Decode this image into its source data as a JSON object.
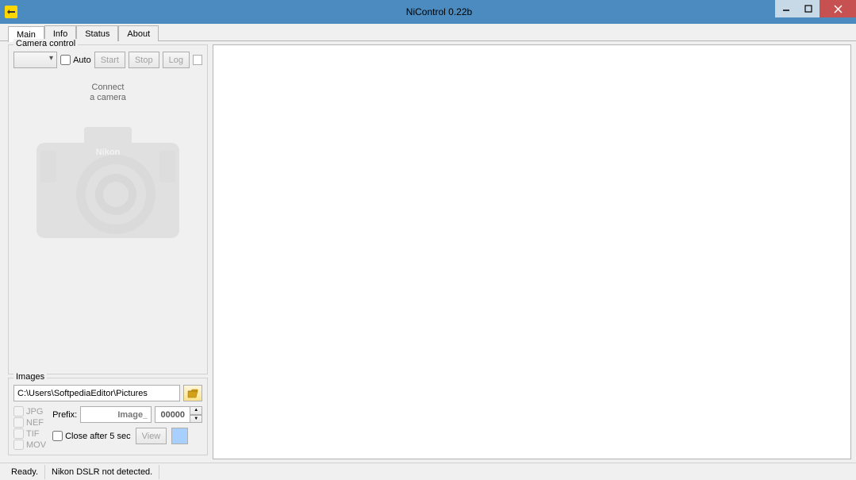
{
  "window": {
    "title": "NiControl 0.22b"
  },
  "tabs": {
    "main": "Main",
    "info": "Info",
    "status": "Status",
    "about": "About"
  },
  "camera_control": {
    "legend": "Camera control",
    "auto_label": "Auto",
    "start_label": "Start",
    "stop_label": "Stop",
    "log_label": "Log",
    "connect_line1": "Connect",
    "connect_line2": "a camera",
    "camera_brand": "Nikon"
  },
  "images": {
    "legend": "Images",
    "path_value": "C:\\Users\\SoftpediaEditor\\Pictures",
    "formats": {
      "jpg": "JPG",
      "nef": "NEF",
      "tif": "TIF",
      "mov": "MOV"
    },
    "prefix_label": "Prefix:",
    "prefix_value": "Image_",
    "counter_value": "00000",
    "close_after_label": "Close after 5 sec",
    "view_label": "View"
  },
  "statusbar": {
    "ready": "Ready.",
    "detection": "Nikon DSLR not detected."
  }
}
